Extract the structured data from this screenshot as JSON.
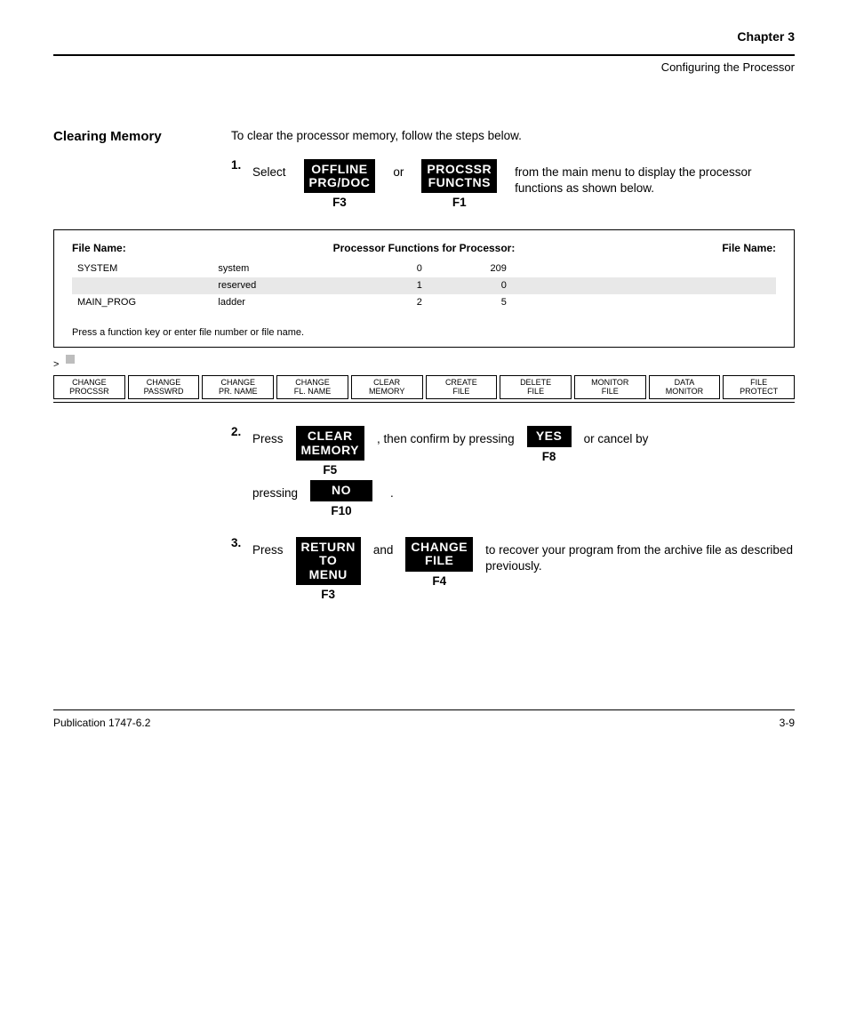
{
  "header": {
    "chapter_label": "Chapter  3",
    "chapter_title": "Configuring the Processor"
  },
  "section": {
    "title": "Clearing Memory",
    "intro": "To clear the processor memory, follow the steps below."
  },
  "steps": {
    "s1": {
      "num": "1.",
      "text_prefix": "Select",
      "mid": "or",
      "text_suffix": "from the main menu to display the processor functions as shown below."
    },
    "s2": {
      "num": "2.",
      "lead": "Press",
      "suffix": ", then confirm by pressing",
      "yes_suffix": "or cancel by",
      "pressing": "pressing",
      "period": "."
    },
    "s3": {
      "num": "3.",
      "lead": "Press",
      "mid": "and",
      "suffix": "to recover your program from the archive file as described previously."
    }
  },
  "keys": {
    "offline": {
      "l1": "OFFLINE",
      "l2": "PRG/DOC",
      "f": "F3"
    },
    "procssr": {
      "l1": "PROCSSR",
      "l2": "FUNCTNS",
      "f": "F1"
    },
    "clearmem": {
      "l1": "CLEAR",
      "l2": "MEMORY",
      "f": "F5"
    },
    "yes": {
      "l1": "YES",
      "f": "F8"
    },
    "no": {
      "l1": "NO",
      "f": "F10"
    },
    "return": {
      "l1": "RETURN",
      "l2": "TO MENU",
      "f": "F3"
    },
    "changefile": {
      "l1": "CHANGE",
      "l2": "FILE",
      "f": "F4"
    }
  },
  "screen": {
    "left_head": "File Name:",
    "center_head": "Processor Functions for Processor:",
    "right_head": "File Name:",
    "rows": [
      {
        "name": "SYSTEM",
        "type": "system",
        "num": "0",
        "words": "209"
      },
      {
        "name": "",
        "type": "reserved",
        "num": "1",
        "words": "0"
      },
      {
        "name": "MAIN_PROG",
        "type": "ladder",
        "num": "2",
        "words": "5"
      }
    ],
    "esc": "Press a function key or enter file number or file name.",
    "cursor": ">"
  },
  "fnbar": [
    {
      "l1": "CHANGE",
      "l2": "PROCSSR"
    },
    {
      "l1": "CHANGE",
      "l2": "PASSWRD"
    },
    {
      "l1": "CHANGE",
      "l2": "PR. NAME"
    },
    {
      "l1": "CHANGE",
      "l2": "FL. NAME"
    },
    {
      "l1": "CLEAR",
      "l2": "MEMORY"
    },
    {
      "l1": "CREATE",
      "l2": "FILE"
    },
    {
      "l1": "DELETE",
      "l2": "FILE"
    },
    {
      "l1": "MONITOR",
      "l2": "FILE"
    },
    {
      "l1": "DATA",
      "l2": "MONITOR"
    },
    {
      "l1": "FILE",
      "l2": "PROTECT"
    }
  ],
  "footer": {
    "pub": "Publication 1747-6.2",
    "page": "3-9"
  }
}
